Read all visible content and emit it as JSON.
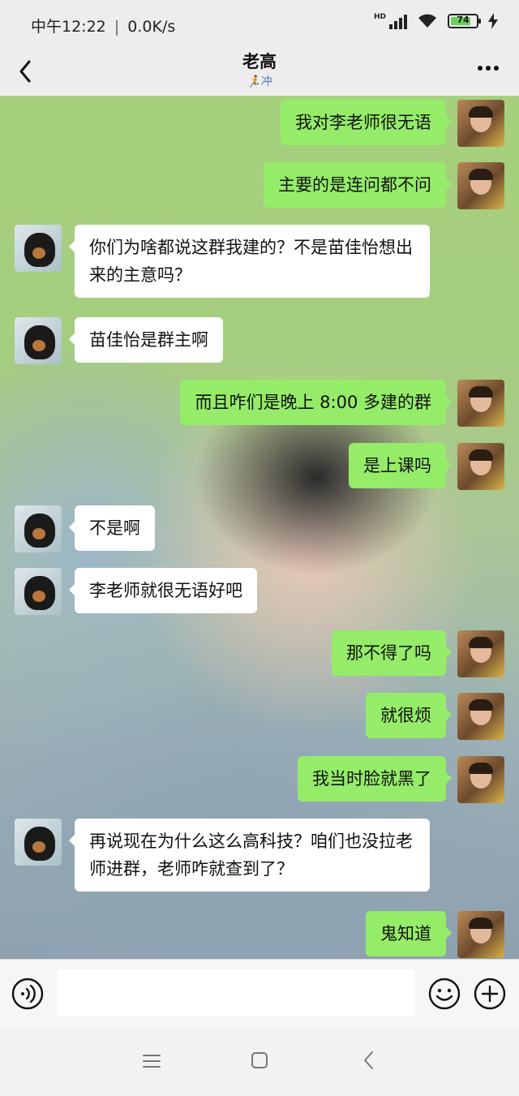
{
  "status_bar": {
    "time": "中午12:22",
    "separator": "|",
    "speed": "0.0K/s",
    "network_badge": "HD",
    "battery_level": "74"
  },
  "header": {
    "title": "老高",
    "subtitle": "冲"
  },
  "messages": [
    {
      "side": "right",
      "text": "我对李老师很无语"
    },
    {
      "side": "right",
      "text": "主要的是连问都不问"
    },
    {
      "side": "left",
      "text": "你们为啥都说这群我建的？不是苗佳怡想出来的主意吗？"
    },
    {
      "side": "left",
      "text": "苗佳怡是群主啊"
    },
    {
      "side": "right",
      "text": "而且咋们是晚上 8:00 多建的群"
    },
    {
      "side": "right",
      "text": "是上课吗"
    },
    {
      "side": "left",
      "text": "不是啊"
    },
    {
      "side": "left",
      "text": "李老师就很无语好吧"
    },
    {
      "side": "right",
      "text": "那不得了吗"
    },
    {
      "side": "right",
      "text": "就很烦"
    },
    {
      "side": "right",
      "text": "我当时脸就黑了"
    },
    {
      "side": "left",
      "text": "再说现在为什么这么高科技？咱们也没拉老师进群，老师咋就查到了？"
    },
    {
      "side": "right",
      "text": "鬼知道"
    }
  ],
  "colors": {
    "sent_bubble": "#95ec69",
    "received_bubble": "#ffffff",
    "subtitle": "#4a7db8"
  },
  "icons": {
    "back": "chevron-left-icon",
    "more": "more-dots-icon",
    "voice": "voice-icon",
    "emoji": "emoji-icon",
    "plus": "plus-icon",
    "nav_menu": "menu-icon",
    "nav_home": "home-square-icon",
    "nav_back": "nav-back-icon"
  }
}
